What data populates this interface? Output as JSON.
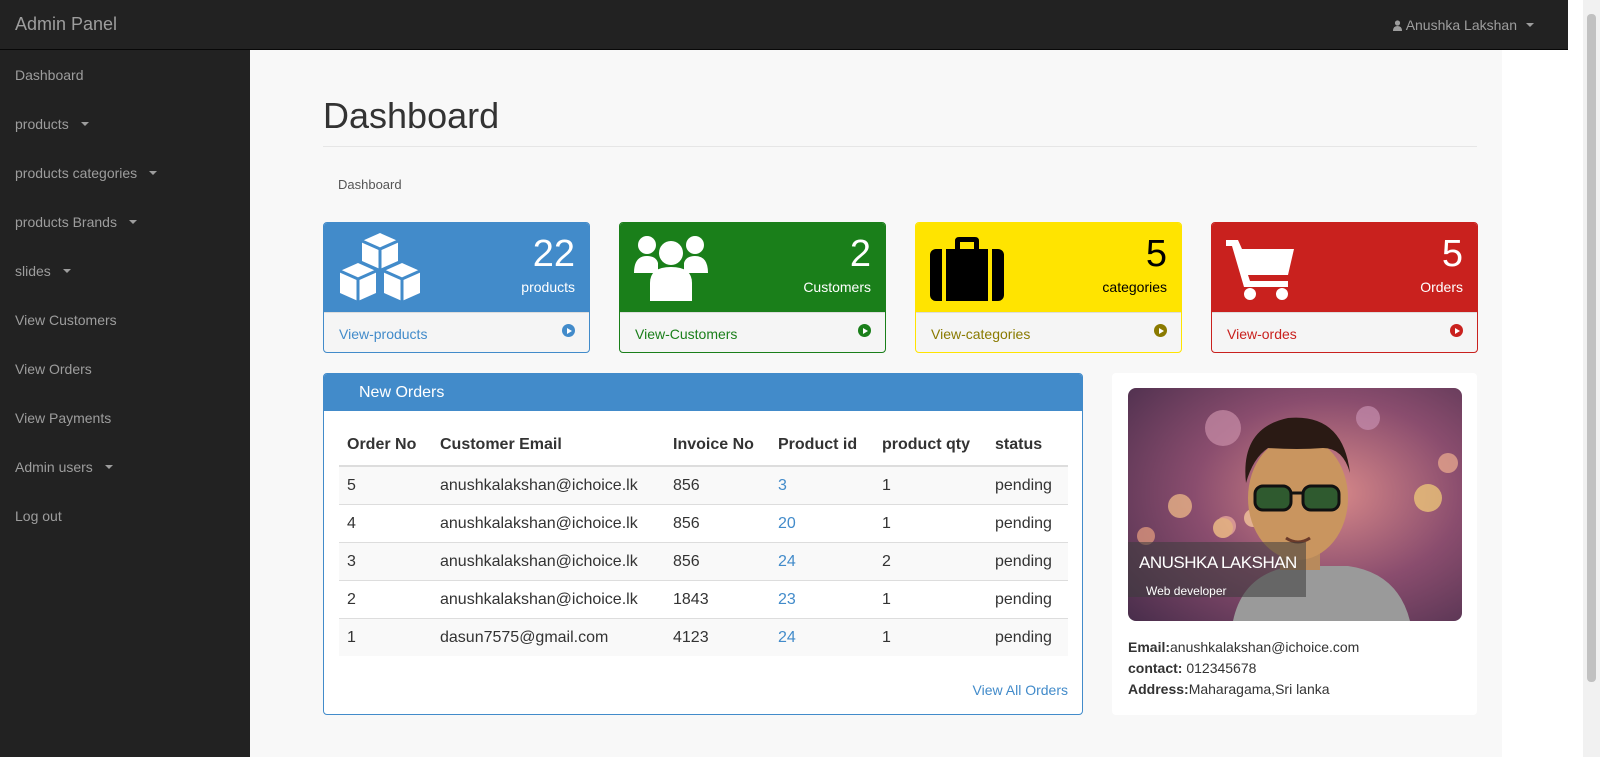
{
  "header": {
    "brand": "Admin Panel",
    "user_name": "Anushka Lakshan"
  },
  "sidebar": {
    "items": [
      {
        "label": "Dashboard"
      },
      {
        "label": "products"
      },
      {
        "label": "products categories"
      },
      {
        "label": "products Brands"
      },
      {
        "label": "slides"
      },
      {
        "label": "View Customers"
      },
      {
        "label": "View Orders"
      },
      {
        "label": "View Payments"
      },
      {
        "label": "Admin users"
      },
      {
        "label": "Log out"
      }
    ]
  },
  "main": {
    "title": "Dashboard",
    "breadcrumb": "Dashboard"
  },
  "stats": [
    {
      "value": "22",
      "label": "products",
      "link": "View-products",
      "color": "#428bca",
      "icon": "cubes-icon"
    },
    {
      "value": "2",
      "label": "Customers",
      "link": "View-Customers",
      "color": "#1a7f1a",
      "icon": "users-icon"
    },
    {
      "value": "5",
      "label": "categories",
      "link": "View-categories",
      "color": "#ffe400",
      "icon": "briefcase-icon"
    },
    {
      "value": "5",
      "label": "Orders",
      "link": "View-ordes",
      "color": "#c9211e",
      "icon": "cart-icon"
    }
  ],
  "orders": {
    "title": "New Orders",
    "columns": [
      "Order No",
      "Customer Email",
      "Invoice No",
      "Product id",
      "product qty",
      "status"
    ],
    "rows": [
      [
        "5",
        "anushkalakshan@ichoice.lk",
        "856",
        "3",
        "1",
        "pending"
      ],
      [
        "4",
        "anushkalakshan@ichoice.lk",
        "856",
        "20",
        "1",
        "pending"
      ],
      [
        "3",
        "anushkalakshan@ichoice.lk",
        "856",
        "24",
        "2",
        "pending"
      ],
      [
        "2",
        "anushkalakshan@ichoice.lk",
        "1843",
        "23",
        "1",
        "pending"
      ],
      [
        "1",
        "dasun7575@gmail.com",
        "4123",
        "24",
        "1",
        "pending"
      ]
    ],
    "view_all": "View All Orders"
  },
  "profile": {
    "name": "ANUSHKA LAKSHAN",
    "role": "Web developer",
    "email_label": "Email:",
    "email": "anushkalakshan@ichoice.com",
    "contact_label": "contact:",
    "contact": " 012345678",
    "address_label": "Address:",
    "address": "Maharagama,Sri lanka"
  }
}
